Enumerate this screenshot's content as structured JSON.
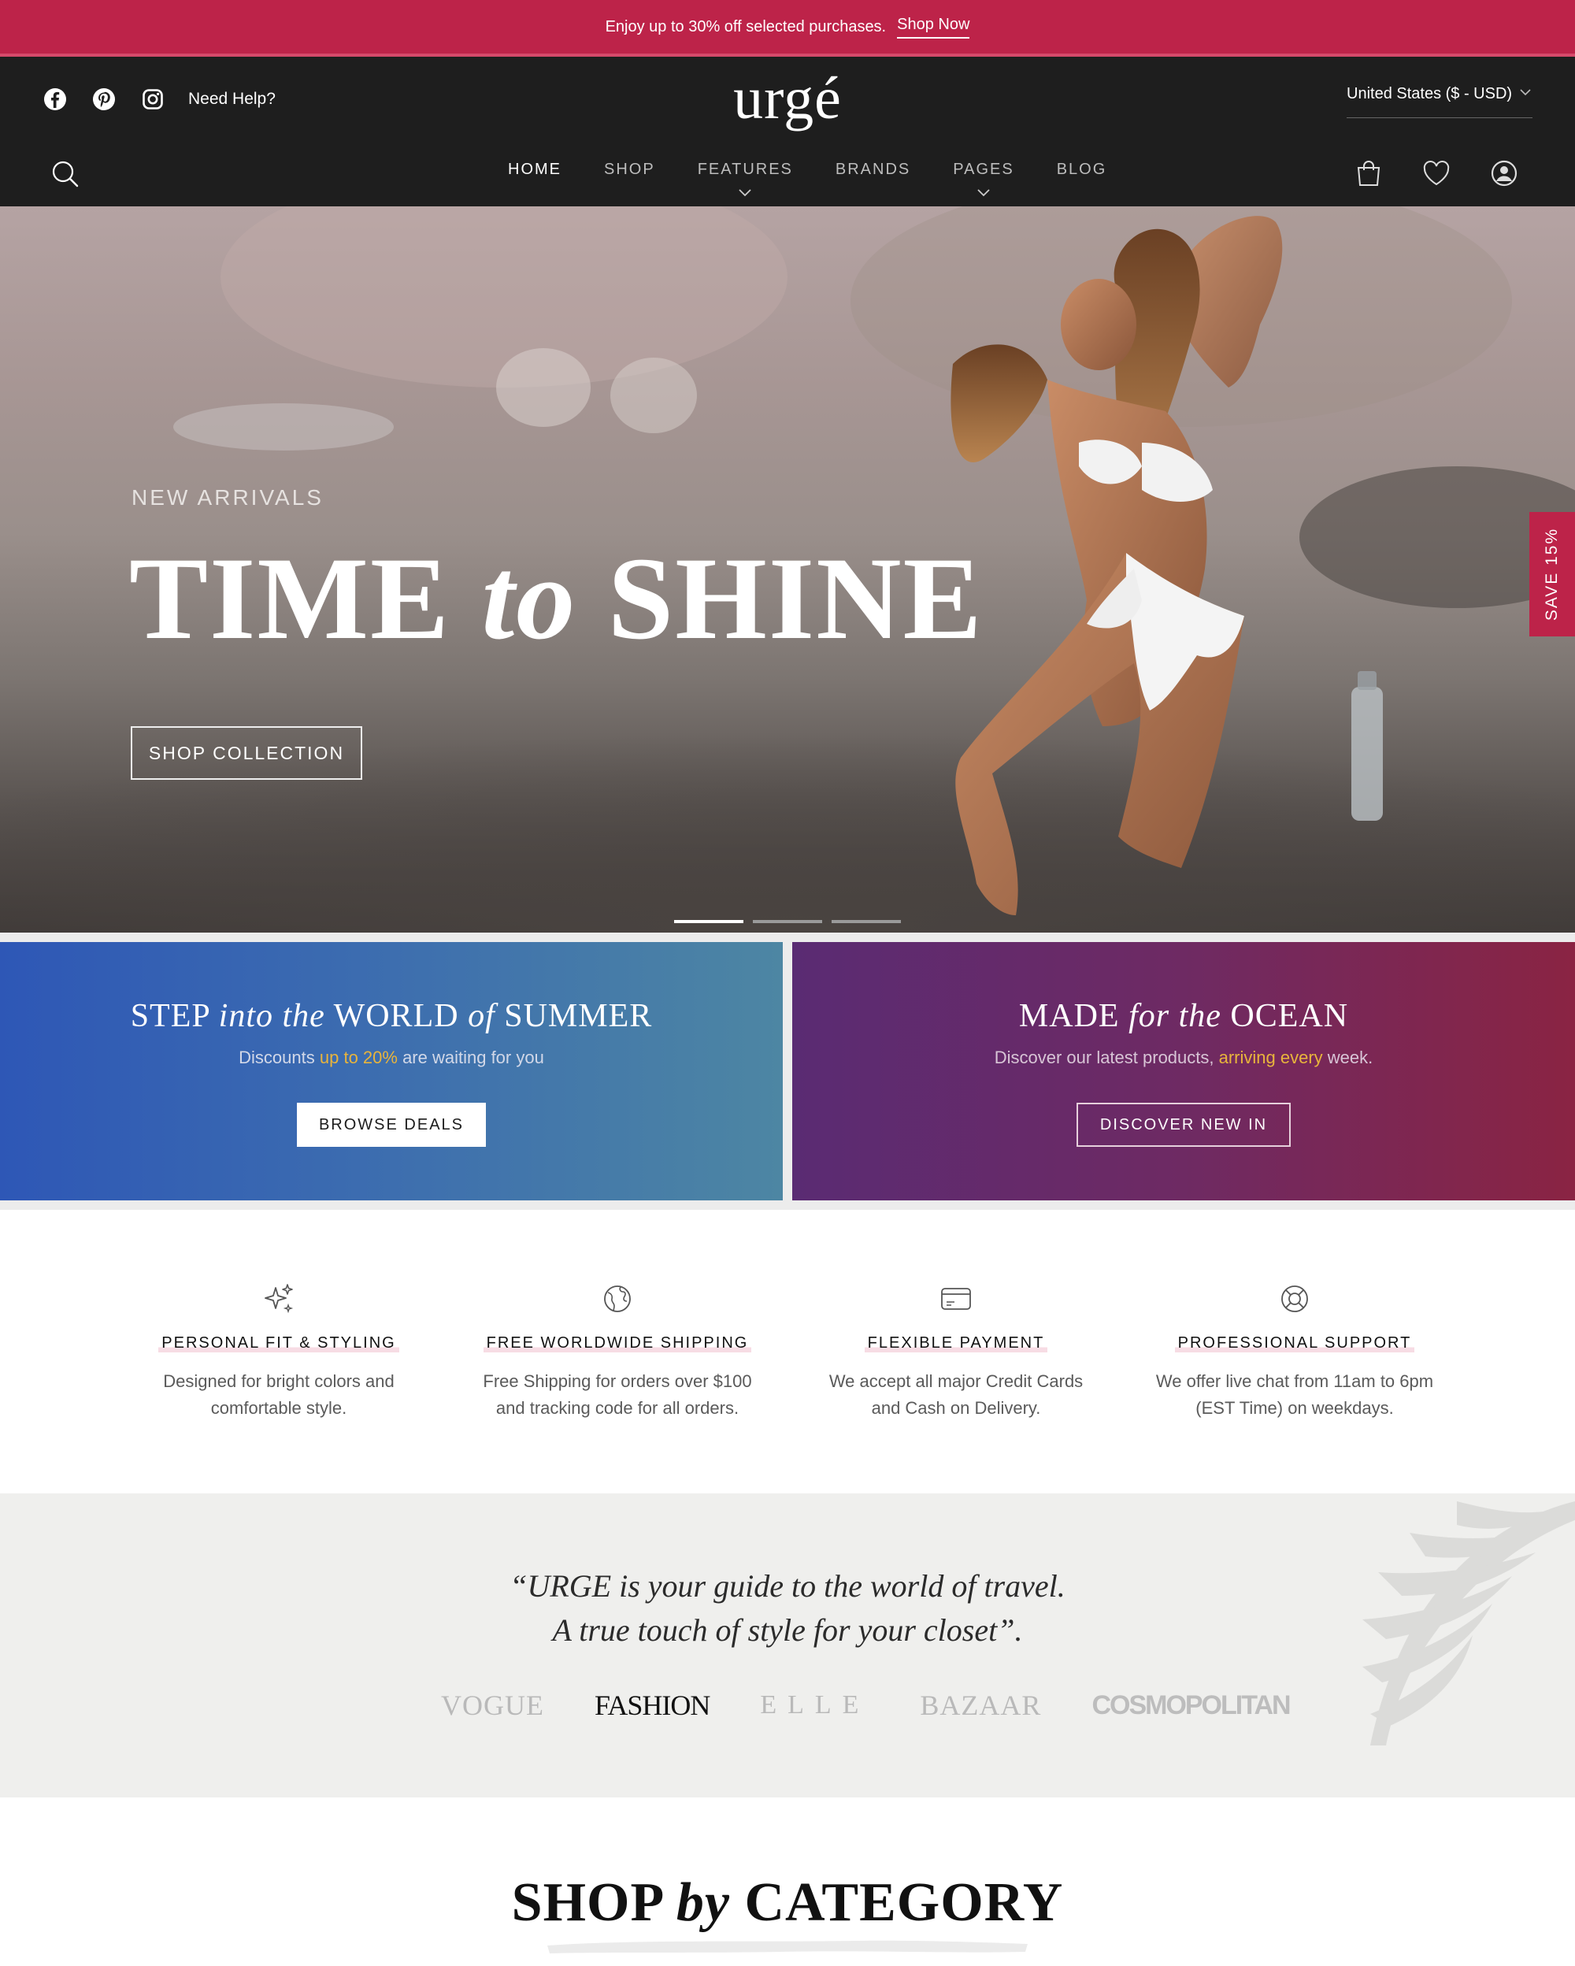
{
  "announcement": {
    "text": "Enjoy up to 30% off selected purchases.",
    "link": "Shop Now"
  },
  "header": {
    "social_icons": [
      "facebook-icon",
      "pinterest-icon",
      "instagram-icon"
    ],
    "help_label": "Need Help?",
    "logo": "urgé",
    "currency": "United States ($ - USD)",
    "nav": [
      {
        "label": "HOME",
        "active": true,
        "dropdown": false
      },
      {
        "label": "SHOP",
        "active": false,
        "dropdown": false
      },
      {
        "label": "FEATURES",
        "active": false,
        "dropdown": true
      },
      {
        "label": "BRANDS",
        "active": false,
        "dropdown": false
      },
      {
        "label": "PAGES",
        "active": false,
        "dropdown": true
      },
      {
        "label": "BLOG",
        "active": false,
        "dropdown": false
      }
    ],
    "right_icons": [
      "bag-icon",
      "heart-icon",
      "account-icon"
    ]
  },
  "hero": {
    "subtitle": "NEW ARRIVALS",
    "title_part1": "TIME",
    "title_italic": "to",
    "title_part2": "SHINE",
    "button": "SHOP COLLECTION",
    "slides_total": 3,
    "active_slide": 1,
    "save_tab": "SAVE 15%"
  },
  "promos": [
    {
      "title_a": "STEP",
      "title_b": "into the",
      "title_c": "WORLD",
      "title_d": "of",
      "title_e": "SUMMER",
      "text_before": "Discounts ",
      "text_highlight": "up to 20%",
      "text_after": " are waiting for you",
      "button": "BROWSE DEALS"
    },
    {
      "title_a": "MADE",
      "title_b": "for the",
      "title_c": "OCEAN",
      "text_before": "Discover our latest products, ",
      "text_highlight": "arriving every",
      "text_after": " week.",
      "button": "DISCOVER NEW IN"
    }
  ],
  "features": [
    {
      "icon": "sparkles-icon",
      "title": "PERSONAL FIT & STYLING",
      "line1": "Designed for bright colors and",
      "line2": "comfortable style."
    },
    {
      "icon": "globe-icon",
      "title": "FREE WORLDWIDE SHIPPING",
      "line1": "Free Shipping for orders over $100",
      "line2": "and tracking code for all orders."
    },
    {
      "icon": "credit-card-icon",
      "title": "FLEXIBLE PAYMENT",
      "line1": "We accept all major Credit Cards",
      "line2": "and Cash on Delivery."
    },
    {
      "icon": "lifebuoy-icon",
      "title": "PROFESSIONAL SUPPORT",
      "line1": "We offer live chat from 11am to 6pm",
      "line2": "(EST Time) on weekdays."
    }
  ],
  "quote": {
    "line1": "“URGE is your guide to the world of travel.",
    "line2": "A true touch of style for your closet”.",
    "brands": [
      "VOGUE",
      "FASHION",
      "ELLE",
      "BAZAAR",
      "COSMOPOLITAN"
    ]
  },
  "category": {
    "title_a": "SHOP",
    "title_b": "by",
    "title_c": "CATEGORY"
  },
  "colors": {
    "accent": "#bd2349",
    "header_bg": "#1e1e1e",
    "highlight": "#e8b43c"
  }
}
